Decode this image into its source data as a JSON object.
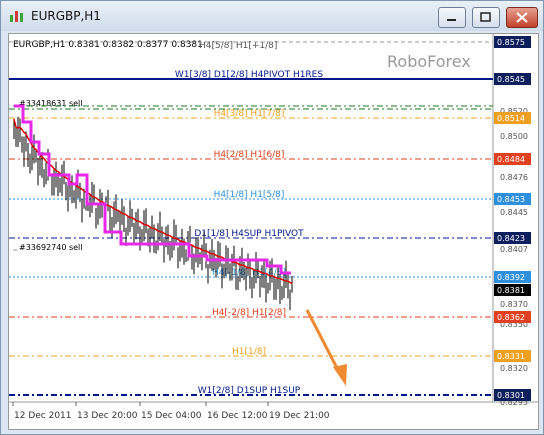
{
  "window": {
    "title": "EURGBP,H1",
    "buttons": [
      "minimize",
      "restore",
      "close"
    ]
  },
  "chart": {
    "header": "EURGBP,H1  0.8381 0.8382 0.8377 0.8381",
    "top_label": "H4[5/8] H1[+1/8]",
    "watermark": "RoboForex",
    "order_labels": [
      "#33418631 sell",
      "#33692740 sell"
    ],
    "colors": {
      "blue": "#001a8c",
      "green": "#1f7a1f",
      "orange": "#f0a020",
      "red": "#e0401e",
      "lightblue": "#2f8fdf",
      "magenta": "#e828e8",
      "trend_red": "#e00000",
      "arrow": "#f08a30"
    },
    "levels": [
      {
        "label": "",
        "price": "0.8575",
        "tag": "dark",
        "style": "dash"
      },
      {
        "label": "W1[3/8] D1[2/8] H4PIVOT H1RES",
        "price": "0.8545",
        "tag": "dark",
        "style": "solid"
      },
      {
        "label": "",
        "price": "",
        "tag": "",
        "style": "green"
      },
      {
        "label": "H4[3/8] H1[7/8]",
        "price": "0.8514",
        "tag": "orange",
        "style": "orange"
      },
      {
        "label": "H4[2/8] H1[6/8]",
        "price": "0.8484",
        "tag": "red",
        "style": "red"
      },
      {
        "label": "H4[1/8] H1[5/8]",
        "price": "0.8453",
        "tag": "blue",
        "style": "blue"
      },
      {
        "label": "D1[1/8] H4SUP H1PIVOT",
        "price": "0.8423",
        "tag": "dark",
        "style": "navy"
      },
      {
        "label": "H4[-1/8] H1[4/8]",
        "price": "0.8392",
        "tag": "blue",
        "style": "blue"
      },
      {
        "label": "",
        "price": "0.8381",
        "tag": "black",
        "style": ""
      },
      {
        "label": "H4[-2/8] H1[2/8]",
        "price": "0.8362",
        "tag": "red",
        "style": "red"
      },
      {
        "label": "H1[1/8]",
        "price": "0.8331",
        "tag": "orange",
        "style": "orange"
      },
      {
        "label": "W1[2/8] D1SUP H1SUP",
        "price": "0.8301",
        "tag": "dark",
        "style": "navy"
      }
    ],
    "axis_prices": [
      "0.8520",
      "0.8500",
      "0.8476",
      "0.8445",
      "0.8407",
      "0.8370",
      "0.8350",
      "0.8320",
      "0.8293"
    ],
    "x_axis": [
      "12 Dec 2011",
      "13 Dec 20:00",
      "15 Dec 04:00",
      "16 Dec 12:00",
      "19 Dec 21:00"
    ]
  }
}
